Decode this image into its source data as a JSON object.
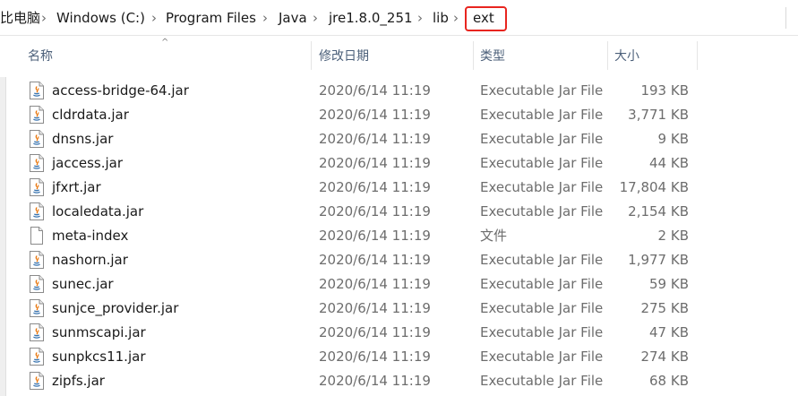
{
  "breadcrumb": {
    "items": [
      "比电脑",
      "Windows (C:)",
      "Program Files",
      "Java",
      "jre1.8.0_251",
      "lib"
    ],
    "current": "ext",
    "separator": "›"
  },
  "columns": {
    "name": "名称",
    "date": "修改日期",
    "type": "类型",
    "size": "大小"
  },
  "files": [
    {
      "name": "access-bridge-64.jar",
      "date": "2020/6/14 11:19",
      "type": "Executable Jar File",
      "size": "193 KB",
      "icon": "jar-file-icon"
    },
    {
      "name": "cldrdata.jar",
      "date": "2020/6/14 11:19",
      "type": "Executable Jar File",
      "size": "3,771 KB",
      "icon": "jar-file-icon"
    },
    {
      "name": "dnsns.jar",
      "date": "2020/6/14 11:19",
      "type": "Executable Jar File",
      "size": "9 KB",
      "icon": "jar-file-icon"
    },
    {
      "name": "jaccess.jar",
      "date": "2020/6/14 11:19",
      "type": "Executable Jar File",
      "size": "44 KB",
      "icon": "jar-file-icon"
    },
    {
      "name": "jfxrt.jar",
      "date": "2020/6/14 11:19",
      "type": "Executable Jar File",
      "size": "17,804 KB",
      "icon": "jar-file-icon"
    },
    {
      "name": "localedata.jar",
      "date": "2020/6/14 11:19",
      "type": "Executable Jar File",
      "size": "2,154 KB",
      "icon": "jar-file-icon"
    },
    {
      "name": "meta-index",
      "date": "2020/6/14 11:19",
      "type": "文件",
      "size": "2 KB",
      "icon": "blank-file-icon"
    },
    {
      "name": "nashorn.jar",
      "date": "2020/6/14 11:19",
      "type": "Executable Jar File",
      "size": "1,977 KB",
      "icon": "jar-file-icon"
    },
    {
      "name": "sunec.jar",
      "date": "2020/6/14 11:19",
      "type": "Executable Jar File",
      "size": "59 KB",
      "icon": "jar-file-icon"
    },
    {
      "name": "sunjce_provider.jar",
      "date": "2020/6/14 11:19",
      "type": "Executable Jar File",
      "size": "275 KB",
      "icon": "jar-file-icon"
    },
    {
      "name": "sunmscapi.jar",
      "date": "2020/6/14 11:19",
      "type": "Executable Jar File",
      "size": "47 KB",
      "icon": "jar-file-icon"
    },
    {
      "name": "sunpkcs11.jar",
      "date": "2020/6/14 11:19",
      "type": "Executable Jar File",
      "size": "274 KB",
      "icon": "jar-file-icon"
    },
    {
      "name": "zipfs.jar",
      "date": "2020/6/14 11:19",
      "type": "Executable Jar File",
      "size": "68 KB",
      "icon": "jar-file-icon"
    }
  ],
  "colors": {
    "highlight_border": "#e8251f",
    "header_text": "#4c607a",
    "detail_text": "#6d6d6d",
    "java_orange": "#e76f00",
    "java_blue": "#3a75b0"
  }
}
